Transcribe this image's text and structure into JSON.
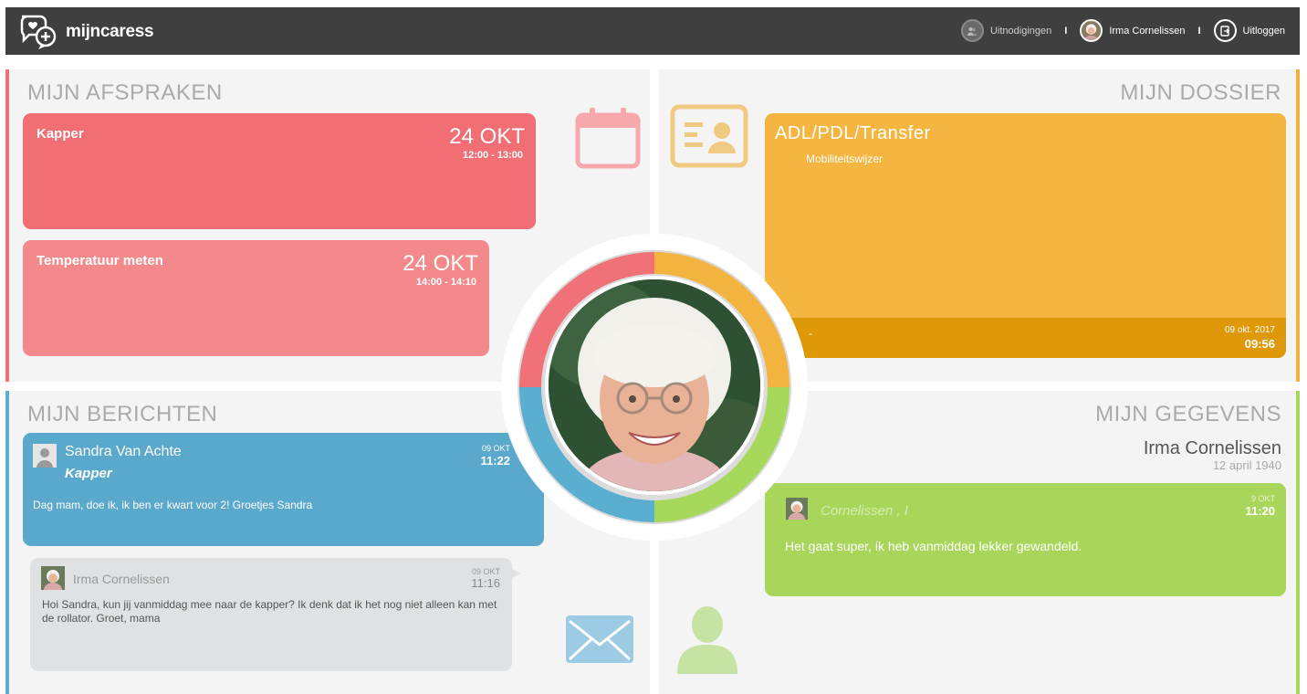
{
  "app": {
    "name": "mijncaress"
  },
  "topbar": {
    "invitations_label": "Uitnodigingen",
    "user_name": "Irma Cornelissen",
    "logout_label": "Uitloggen",
    "separator": "I"
  },
  "colors": {
    "afspraken": "#f07278",
    "dossier": "#f3b43f",
    "berichten": "#5aaed0",
    "gegevens": "#a6d85c"
  },
  "afspraken": {
    "title": "MIJN AFSPRAKEN",
    "icon": "calendar-icon",
    "items": [
      {
        "title": "Kapper",
        "date": "24 OKT",
        "time": "12:00 - 13:00"
      },
      {
        "title": "Temperatuur meten",
        "date": "24 OKT",
        "time": "14:00 - 14:10"
      }
    ]
  },
  "dossier": {
    "title": "MIJN DOSSIER",
    "icon": "id-card-icon",
    "card": {
      "title": "ADL/PDL/Transfer",
      "subtitle": "Mobiliteitswijzer",
      "footer_text": "-",
      "date": "09 okt. 2017",
      "time": "09:56"
    }
  },
  "berichten": {
    "title": "MIJN BERICHTEN",
    "icon": "envelope-icon",
    "messages": [
      {
        "from": "Sandra Van Achte",
        "subject": "Kapper",
        "body": "Dag mam, doe ik, ik ben er kwart voor 2! Groetjes Sandra",
        "date": "09 OKT",
        "time": "11:22"
      },
      {
        "from": "Irma Cornelissen",
        "body": "Hoi Sandra, kun jij vanmiddag mee naar de kapper? Ik denk dat ik het nog niet alleen kan met de rollator. Groet, mama",
        "date": "09 OKT",
        "time": "11:16"
      }
    ]
  },
  "gegevens": {
    "title": "MIJN GEGEVENS",
    "icon": "user-icon",
    "name": "Irma Cornelissen",
    "dob": "12 april 1940",
    "message": {
      "from": "Cornelissen , I",
      "body": "Het gaat super, ik heb vanmiddag lekker gewandeld.",
      "date": "9 OKT",
      "time": "11:20"
    }
  }
}
